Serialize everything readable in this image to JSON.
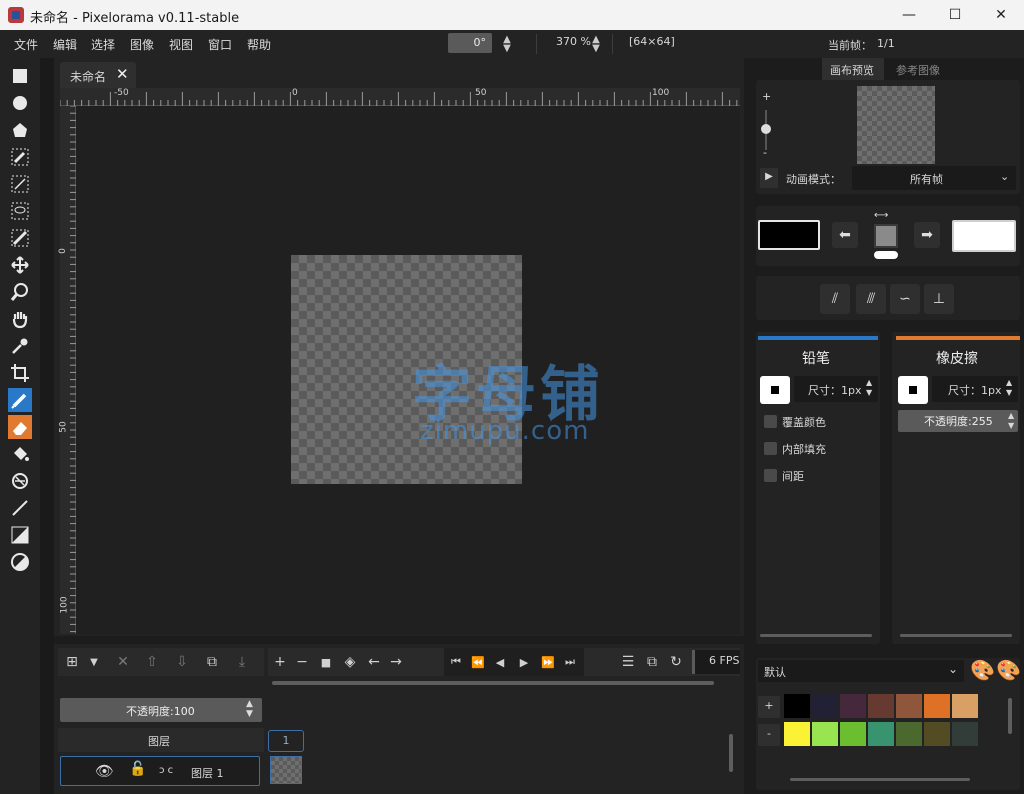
{
  "window": {
    "title": "未命名 - Pixelorama v0.11-stable",
    "minimize": "—",
    "maximize": "☐",
    "close": "✕"
  },
  "menu": [
    "文件",
    "编辑",
    "选择",
    "图像",
    "视图",
    "窗口",
    "帮助"
  ],
  "top_bar": {
    "rotation": "0°",
    "zoom": "370 %",
    "canvas_size": "[64×64]",
    "current_frame_label": "当前帧：",
    "current_frame_value": "1/1"
  },
  "canvas_tab": {
    "name": "未命名",
    "close": "✕"
  },
  "ruler": {
    "horizontal": [
      "-50",
      "0",
      "50",
      "100"
    ],
    "vertical": [
      "0",
      "50",
      "100"
    ]
  },
  "watermark": {
    "main": "字母铺",
    "sub": "zimupu.com"
  },
  "preview": {
    "tabs": [
      "画布预览",
      "参考图像"
    ],
    "zoom_plus": "+",
    "zoom_minus": "-",
    "animation_mode_label": "动画模式：",
    "animation_mode_value": "所有帧"
  },
  "colors": {
    "left": "#000000",
    "right": "#ffffff",
    "accent_left": "#2a78c8",
    "accent_right": "#e07a30"
  },
  "left_tool_options": {
    "title": "铅笔",
    "size_label": "尺寸：1px",
    "checkboxes": [
      "覆盖颜色",
      "内部填充",
      "间距"
    ]
  },
  "right_tool_options": {
    "title": "橡皮擦",
    "size_label": "尺寸：1px",
    "opacity_label": "不透明度:255"
  },
  "layers": {
    "opacity_label": "不透明度:100",
    "header": "图层",
    "frame_number": "1",
    "layer_name": "图层 1",
    "fps": "6 FPS",
    "link_icons": "ↄ c"
  },
  "palette": {
    "name": "默认",
    "add": "+",
    "remove": "-",
    "swatches_row1": [
      "#000000",
      "#222034",
      "#45283c",
      "#663931",
      "#8f563b",
      "#df7126",
      "#d9a066"
    ],
    "swatches_row2": [
      "#fbf236",
      "#99e550",
      "#6abe30",
      "#37946e",
      "#4b692f",
      "#524b24",
      "#323c39"
    ]
  }
}
